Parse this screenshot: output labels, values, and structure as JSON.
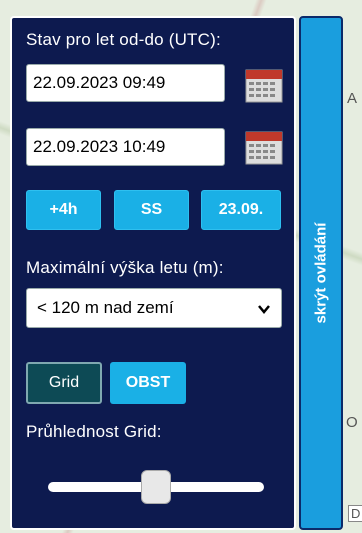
{
  "panel": {
    "range_label": "Stav pro let od-do (UTC):",
    "date_from": "22.09.2023 09:49",
    "date_to": "22.09.2023 10:49",
    "buttons": {
      "plus4h": "+4h",
      "ss": "SS",
      "date": "23.09."
    },
    "height_label": "Maximální výška letu (m):",
    "height_select": {
      "selected": "< 120 m nad zemí"
    },
    "layer_buttons": {
      "grid": "Grid",
      "obst": "OBST"
    },
    "opacity_label": "Průhlednost Grid:",
    "opacity_value": 0.5,
    "hide_tab_label": "skrýt ovládání"
  },
  "map": {
    "labels": [
      "A",
      "O",
      "D"
    ]
  },
  "colors": {
    "panel_bg": "#0d1a4f",
    "accent": "#1ab0e6",
    "grid_active": "#0d4a55",
    "hide_tab": "#1a9ede"
  }
}
